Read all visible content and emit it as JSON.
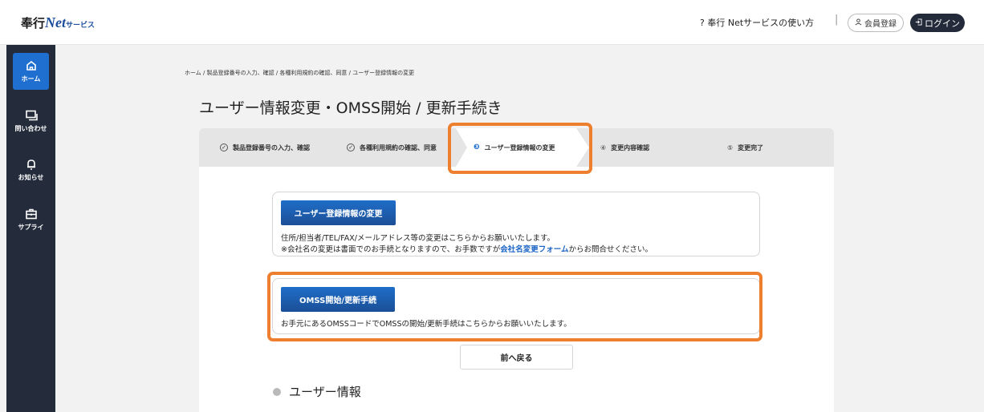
{
  "header": {
    "logo_main": "奉行",
    "logo_net": "Net",
    "logo_sub": "サービス",
    "help_icon": "question-circle-icon",
    "help_link": "奉行 Netサービスの使い方",
    "separator": "|",
    "register_icon": "person-icon",
    "register_label": "会員登録",
    "login_icon": "login-icon",
    "login_label": "ログイン"
  },
  "sidebar": {
    "items": [
      {
        "label": "ホーム",
        "icon": "home-icon",
        "active": true
      },
      {
        "label": "問い合わせ",
        "icon": "chat-icon",
        "active": false
      },
      {
        "label": "お知らせ",
        "icon": "bell-icon",
        "active": false
      },
      {
        "label": "サプライ",
        "icon": "briefcase-icon",
        "active": false
      }
    ]
  },
  "breadcrumb": "ホーム / 製品登録番号の入力、確認 / 各種利用規約の確認、同意 / ユーザー登録情報の変更",
  "page_title": "ユーザー情報変更・OMSS開始 / 更新手続き",
  "steps": [
    {
      "marker": "✓",
      "label": "製品登録番号の入力、確認"
    },
    {
      "marker": "✓",
      "label": "各種利用規約の確認、同意"
    },
    {
      "marker": "❸",
      "label": "ユーザー登録情報の変更"
    },
    {
      "marker": "④",
      "label": "変更内容確認"
    },
    {
      "marker": "⑤",
      "label": "変更完了"
    }
  ],
  "user_card": {
    "button": "ユーザー登録情報の変更",
    "line1": "住所/担当者/TEL/FAX/メールアドレス等の変更はこちらからお願いいたします。",
    "line2_pre": "※会社名の変更は書面でのお手続となりますので、お手数ですが",
    "line2_link": "会社名変更フォーム",
    "line2_post": "からお問合せください。"
  },
  "omss_card": {
    "button": "OMSS開始/更新手続",
    "line1": "お手元にあるOMSSコードでOMSSの開始/更新手続はこちらからお願いいたします。"
  },
  "back_button": "前へ戻る",
  "section_title": "ユーザー情報",
  "colors": {
    "accent": "#1f6fd1",
    "highlight": "#ee7f2e",
    "sidebar": "#242c3c"
  }
}
